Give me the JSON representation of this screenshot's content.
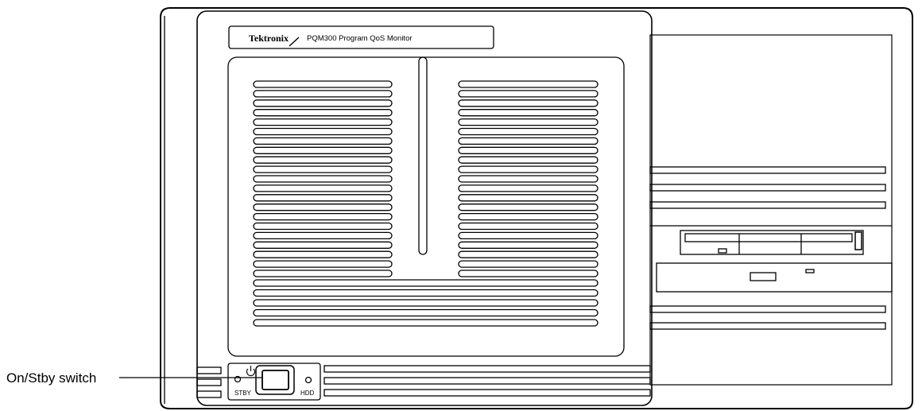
{
  "panel": {
    "brand": "Tektronix",
    "model": "PQM300 Program QoS Monitor"
  },
  "controls": {
    "standby_label": "STBY",
    "hdd_label": "HDD"
  },
  "callouts": {
    "power_switch": "On/Stby switch"
  }
}
